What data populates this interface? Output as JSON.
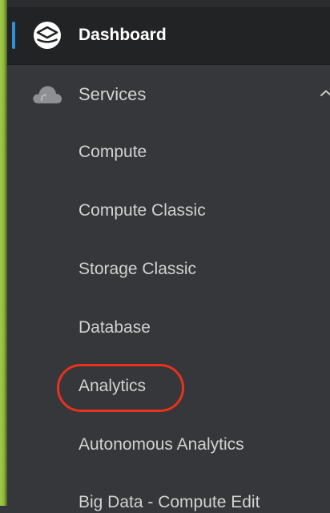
{
  "nav": {
    "dashboard": {
      "label": "Dashboard",
      "icon": "dashboard-icon"
    },
    "services": {
      "label": "Services",
      "icon": "cloud-icon",
      "expanded": true,
      "expand_icon": "chevron-up-icon"
    },
    "sub_items": [
      {
        "label": "Compute"
      },
      {
        "label": "Compute Classic"
      },
      {
        "label": "Storage Classic"
      },
      {
        "label": "Database"
      },
      {
        "label": "Analytics",
        "highlighted": true
      },
      {
        "label": "Autonomous Analytics"
      },
      {
        "label": "Big Data - Compute Edit"
      }
    ]
  },
  "colors": {
    "sidebar_bg": "#35373a",
    "dashboard_bg": "#222325",
    "active_indicator": "#2e90d6",
    "highlight_ring": "#e8321c",
    "left_strip": "#a2cb45"
  }
}
